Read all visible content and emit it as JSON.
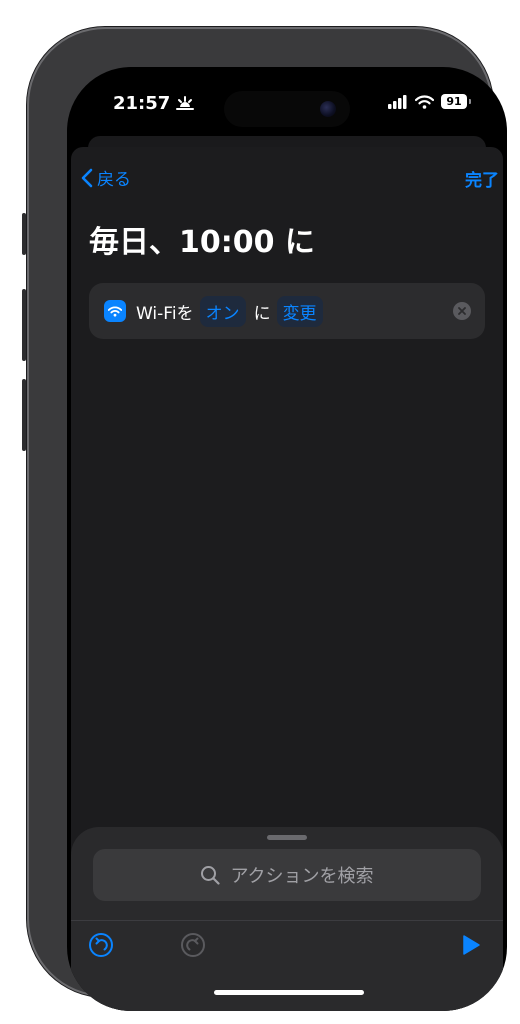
{
  "status": {
    "time": "21:57",
    "battery": "91",
    "time_icon": "sunrise-icon"
  },
  "nav": {
    "back_label": "戻る",
    "done_label": "完了"
  },
  "title": "毎日、10:00 に",
  "action": {
    "prefix": "Wi-Fiを",
    "state_chip": "オン",
    "middle": "に",
    "verb_chip": "変更"
  },
  "search": {
    "placeholder": "アクションを検索"
  },
  "colors": {
    "accent": "#0a84ff",
    "sheet": "#1c1c1e",
    "card": "#2c2c2e"
  }
}
